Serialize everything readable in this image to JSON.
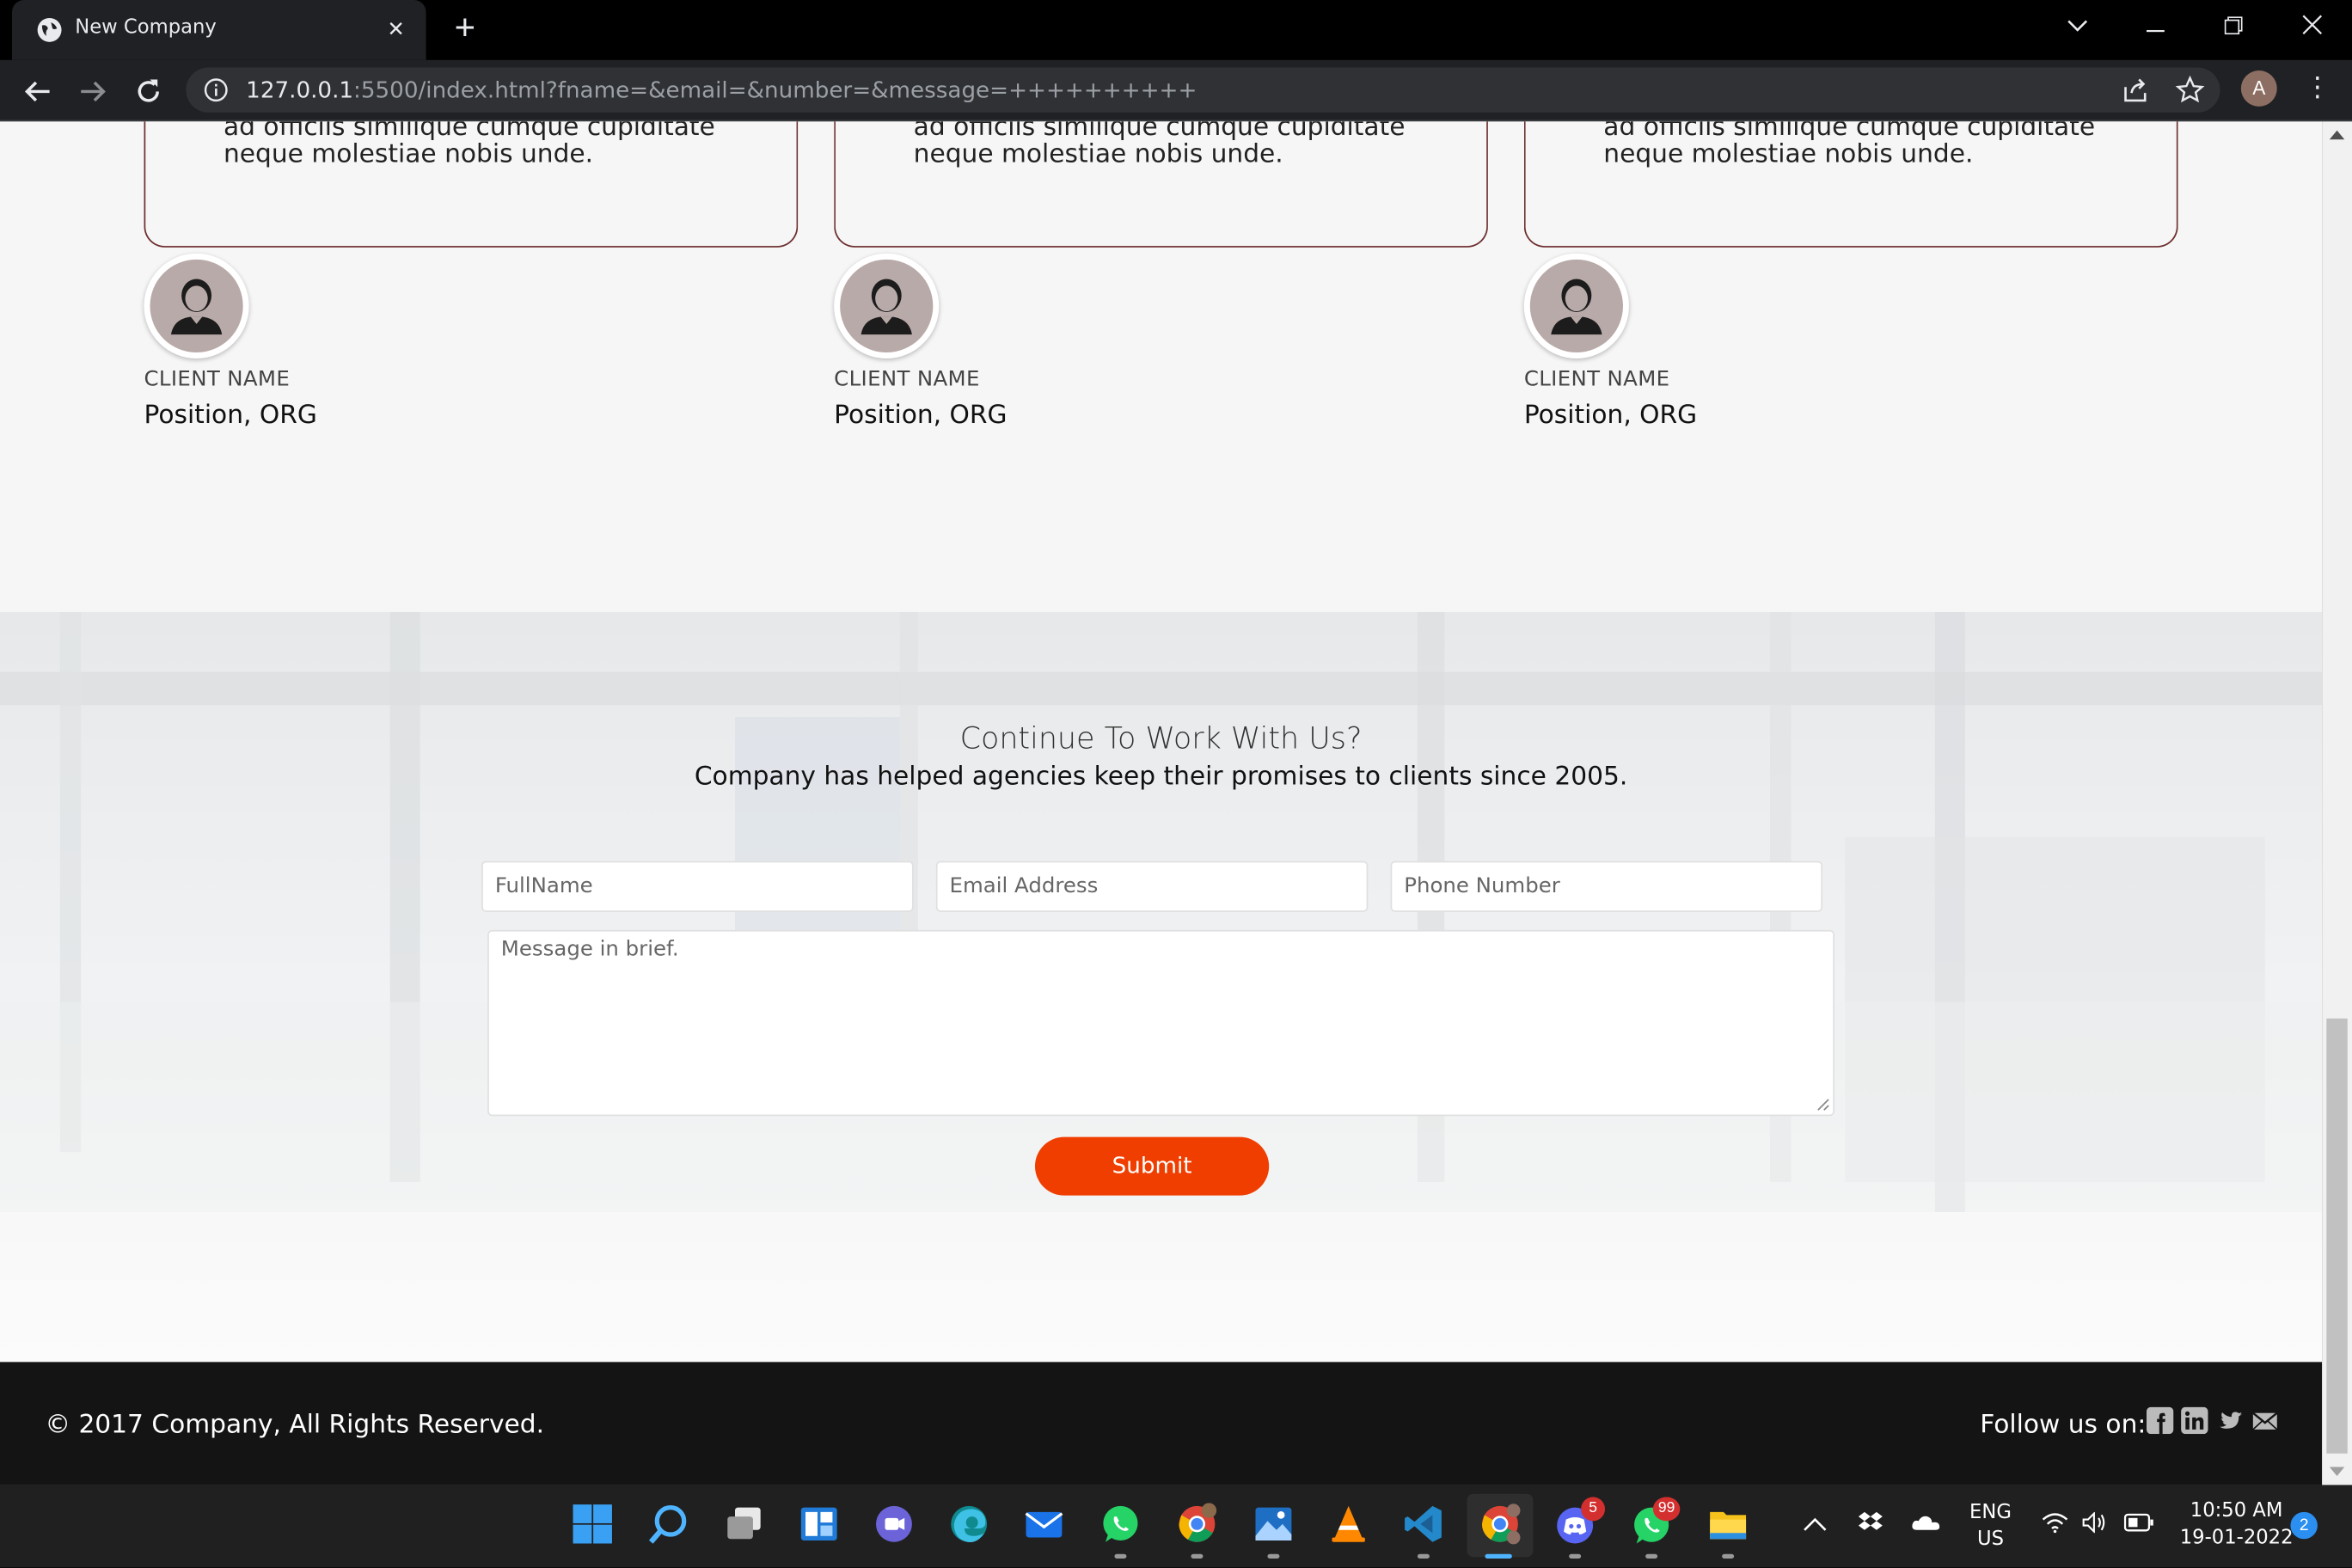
{
  "browser": {
    "tab_title": "New Company",
    "url_host": "127.0.0.1",
    "url_rest": ":5500/index.html?fname=&email=&number=&message=++++++++++",
    "profile_initial": "A"
  },
  "testimonials": [
    {
      "quote_cut": "ad officiis similique cumque cupiditate",
      "quote": "neque molestiae nobis unde.",
      "client_name": "CLIENT NAME",
      "position": "Position, ORG"
    },
    {
      "quote_cut": "ad officiis similique cumque cupiditate",
      "quote": "neque molestiae nobis unde.",
      "client_name": "CLIENT NAME",
      "position": "Position, ORG"
    },
    {
      "quote_cut": "ad officiis similique cumque cupiditate",
      "quote": "neque molestiae nobis unde.",
      "client_name": "CLIENT NAME",
      "position": "Position, ORG"
    }
  ],
  "contact": {
    "title": "Continue To Work With Us?",
    "subtitle": "Company has helped agencies keep their promises to clients since 2005.",
    "fullname_placeholder": "FullName",
    "email_placeholder": "Email Address",
    "phone_placeholder": "Phone Number",
    "message_placeholder": "Message in brief.",
    "submit_label": "Submit"
  },
  "footer": {
    "copyright": "© 2017 Company, All Rights Reserved.",
    "follow_label": "Follow us on:",
    "social_icons": [
      "facebook-icon",
      "linkedin-icon",
      "twitter-icon",
      "mail-icon"
    ]
  },
  "taskbar": {
    "lang_top": "ENG",
    "lang_bottom": "US",
    "time": "10:50 AM",
    "date": "19-01-2022",
    "discord_badge": "5",
    "whatsapp_badge": "99",
    "notification_count": "2"
  },
  "colors": {
    "accent": "#f03e00",
    "card_border": "#6d2d2d",
    "footer_bg": "#141414"
  }
}
